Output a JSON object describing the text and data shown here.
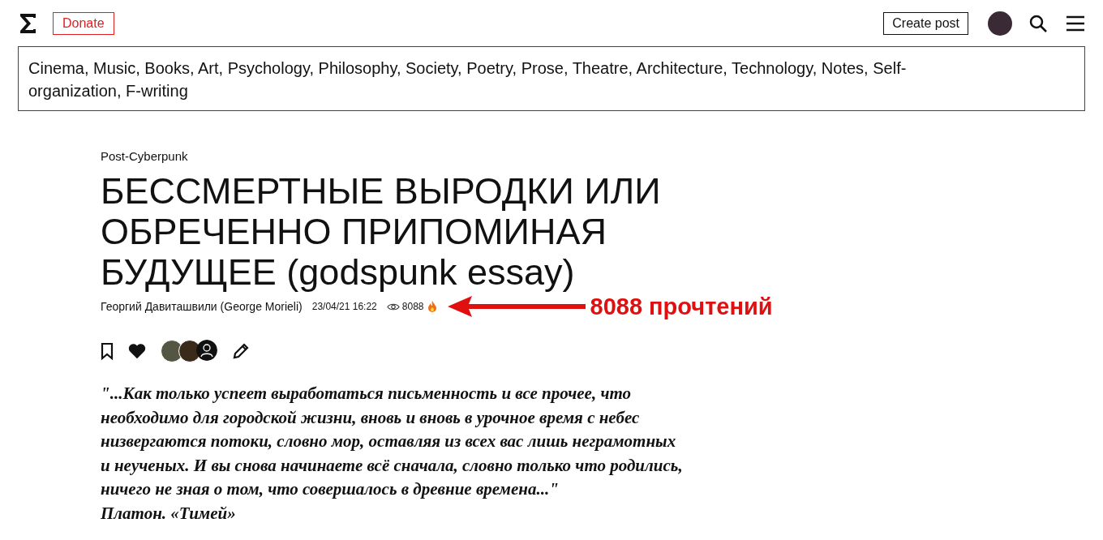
{
  "header": {
    "donate": "Donate",
    "create_post": "Create post"
  },
  "categories": "Cinema, Music, Books, Art, Psychology, Philosophy, Society, Poetry, Prose, Theatre, Architecture, Technology, Notes, Self-organization, F-writing",
  "post": {
    "category": "Post-Cyberpunk",
    "title": "БЕССМЕРТНЫЕ ВЫРОДКИ ИЛИ ОБРЕЧЕННО ПРИПОМИНАЯ БУДУЩЕЕ (godspunk essay)",
    "author": "Георгий Давиташвили (George Morieli)",
    "date": "23/04/21 16:22",
    "views": "8088",
    "quote_lines": [
      "\"...Как только успеет выработаться письменность и все прочее, что",
      "необходимо для городской жизни, вновь и вновь в урочное время с небес",
      "низвергаются потоки, словно мор, оставляя из всех вас лишь неграмотных",
      "и неученых. И вы снова начинаете всё сначала, словно только что родились,",
      "ничего не зная о том, что совершалось в древние времена...\""
    ],
    "quote_source": "Платон. «Тимей»"
  },
  "annotation": "8088 прочтений"
}
